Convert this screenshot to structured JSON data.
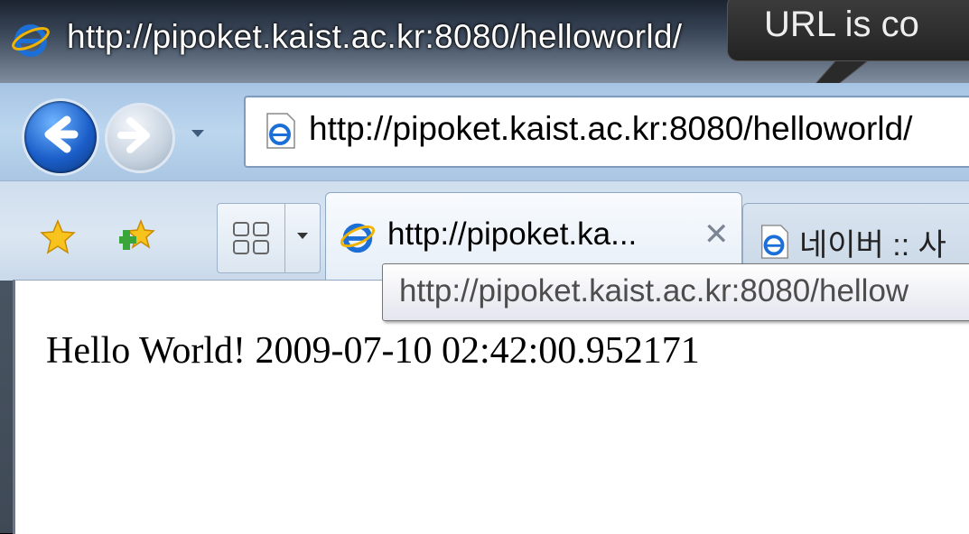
{
  "window": {
    "title": "http://pipoket.kaist.ac.kr:8080/helloworld/"
  },
  "callout": {
    "text": "URL is co"
  },
  "address_bar": {
    "url": "http://pipoket.kaist.ac.kr:8080/helloworld/"
  },
  "tabs": [
    {
      "label": "http://pipoket.ka...",
      "close": "✕",
      "active": true
    },
    {
      "label": "네이버 :: 사",
      "active": false
    }
  ],
  "tooltip": {
    "text": "http://pipoket.kaist.ac.kr:8080/hellow"
  },
  "page": {
    "text": "Hello World! 2009-07-10 02:42:00.952171"
  },
  "colors": {
    "ie_blue": "#1b6fd6",
    "ie_ring": "#f0b400",
    "star_yellow": "#f7c31c",
    "plus_green": "#3aa53a"
  }
}
